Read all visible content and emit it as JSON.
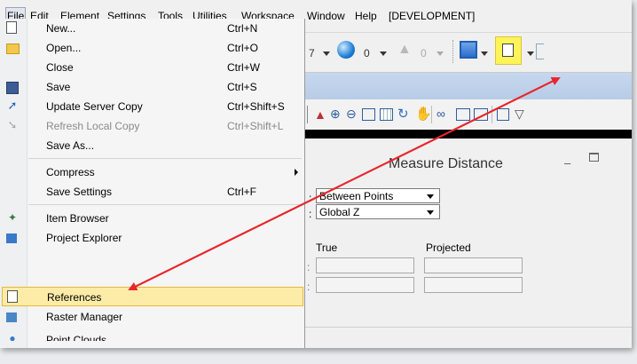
{
  "menubar": {
    "items": [
      "File",
      "Edit",
      "Element",
      "Settings",
      "Tools",
      "Utilities",
      "Workspace",
      "Window",
      "Help",
      "[DEVELOPMENT]"
    ]
  },
  "file_menu": {
    "items": [
      {
        "label": "New...",
        "shortcut": "Ctrl+N",
        "icon": "new-file-icon",
        "enabled": true
      },
      {
        "label": "Open...",
        "shortcut": "Ctrl+O",
        "icon": "open-folder-icon",
        "enabled": true
      },
      {
        "label": "Close",
        "shortcut": "Ctrl+W",
        "icon": "",
        "enabled": true
      },
      {
        "label": "Save",
        "shortcut": "Ctrl+S",
        "icon": "save-icon",
        "enabled": true
      },
      {
        "label": "Update Server Copy",
        "shortcut": "Ctrl+Shift+S",
        "icon": "upload-arrow-icon",
        "enabled": true
      },
      {
        "label": "Refresh Local Copy",
        "shortcut": "Ctrl+Shift+L",
        "icon": "refresh-icon",
        "enabled": false
      },
      {
        "label": "Save As...",
        "shortcut": "",
        "icon": "",
        "enabled": true
      },
      {
        "label": "Compress",
        "shortcut": "",
        "icon": "",
        "enabled": true
      },
      {
        "label": "Save Settings",
        "shortcut": "Ctrl+F",
        "icon": "",
        "enabled": true
      },
      {
        "label": "Item Browser",
        "shortcut": "",
        "icon": "item-browser-icon",
        "enabled": true
      },
      {
        "label": "Project Explorer",
        "shortcut": "",
        "icon": "project-explorer-icon",
        "enabled": true
      },
      {
        "label": "References",
        "shortcut": "",
        "icon": "references-icon",
        "enabled": true
      },
      {
        "label": "Raster Manager",
        "shortcut": "",
        "icon": "raster-manager-icon",
        "enabled": true
      },
      {
        "label": "Point Clouds",
        "shortcut": "",
        "icon": "point-clouds-icon",
        "enabled": true
      }
    ]
  },
  "toolbar": {
    "level_value": "7",
    "color_value": "0",
    "style_value": "0"
  },
  "measure_panel": {
    "title": "Measure Distance",
    "method_value": "Between Points",
    "axis_value": "Global Z",
    "col_true": "True",
    "col_projected": "Projected"
  },
  "colors": {
    "annotation_arrow": "#e8262b",
    "highlight_fill": "#fdeca8",
    "toolbar_highlight": "#fff35a"
  }
}
